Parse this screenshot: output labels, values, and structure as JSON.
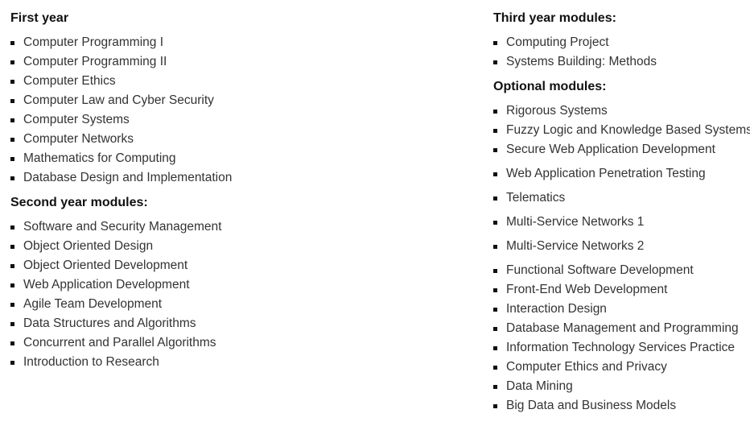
{
  "first_year": {
    "heading": "First year",
    "items": [
      "Computer Programming I",
      "Computer Programming II",
      "Computer Ethics",
      "Computer Law and Cyber Security",
      "Computer Systems",
      "Computer Networks",
      "Mathematics for Computing",
      "Database Design and Implementation"
    ]
  },
  "second_year": {
    "heading": "Second year modules:",
    "items": [
      "Software and Security Management",
      "Object Oriented Design",
      "Object Oriented Development",
      "Web Application Development",
      "Agile Team Development",
      "Data Structures and Algorithms",
      "Concurrent and Parallel Algorithms",
      "Introduction to Research"
    ]
  },
  "third_year": {
    "heading": "Third year modules:",
    "items": [
      "Computing Project",
      "Systems Building: Methods"
    ]
  },
  "optional": {
    "heading": "Optional modules:",
    "items": [
      "Rigorous Systems",
      "Fuzzy Logic and Knowledge Based Systems",
      "Secure Web Application Development",
      "Web Application Penetration Testing",
      "Telematics",
      "Multi-Service Networks 1",
      "Multi-Service Networks 2",
      "Functional Software Development",
      "Front-End Web Development",
      "Interaction Design",
      "Database Management and Programming",
      "Information Technology Services Practice",
      "Computer Ethics and Privacy",
      "Data Mining",
      "Big Data and Business Models"
    ]
  }
}
